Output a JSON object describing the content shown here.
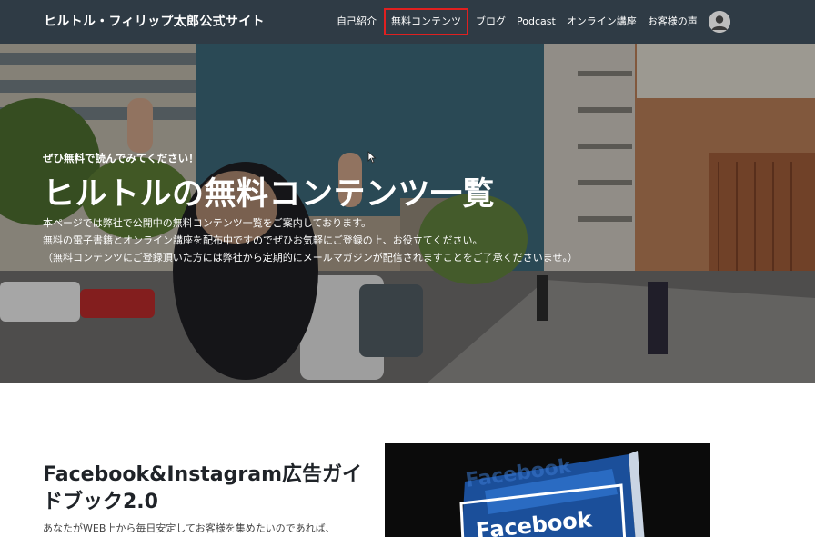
{
  "header": {
    "site_title": "ヒルトル・フィリップ太郎公式サイト",
    "nav": [
      {
        "label": "自己紹介"
      },
      {
        "label": "無料コンテンツ",
        "active": true
      },
      {
        "label": "ブログ"
      },
      {
        "label": "Podcast"
      },
      {
        "label": "オンライン講座"
      },
      {
        "label": "お客様の声"
      }
    ],
    "avatar_icon": "user-avatar-icon"
  },
  "hero": {
    "kicker": "ぜひ無料で読んでみてください！",
    "title": "ヒルトルの無料コンテンツ一覧",
    "description": [
      "本ページでは弊社で公開中の無料コンテンツ一覧をご案内しております。",
      "無料の電子書籍とオンライン講座を配布中ですのでぜひお気軽にご登録の上、お役立てください。",
      "（無料コンテンツにご登録頂いた方には弊社から定期的にメールマガジンが配信されますことをご了承くださいませ。）"
    ]
  },
  "content": {
    "product_title": "Facebook&Instagram広告ガイドブック2.0",
    "product_desc": "あなたがWEB上から毎日安定してお客様を集めたいのであれば、",
    "book_cover_text": "Facebook"
  },
  "colors": {
    "header_bg": "#2f3b45",
    "active_outline": "#e02020",
    "text_dark": "#1f2328"
  }
}
